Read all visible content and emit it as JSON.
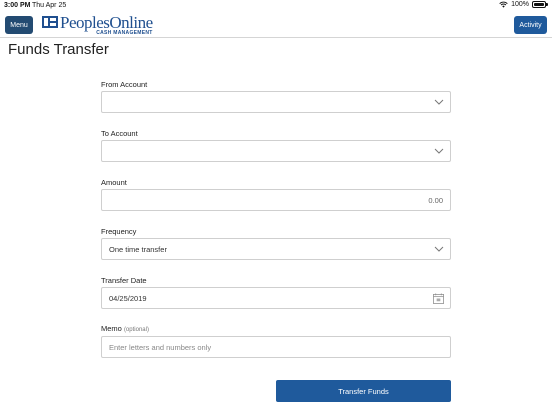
{
  "status_bar": {
    "time": "3:00 PM",
    "date": "Thu Apr 25",
    "battery": "100%",
    "battery_level": 1.0
  },
  "header": {
    "menu_label": "Menu",
    "activity_label": "Activity",
    "logo": {
      "name": "PeoplesOnline",
      "subtitle": "CASH MANAGEMENT"
    }
  },
  "page": {
    "title": "Funds Transfer"
  },
  "form": {
    "from_account": {
      "label": "From Account",
      "value": ""
    },
    "to_account": {
      "label": "To Account",
      "value": ""
    },
    "amount": {
      "label": "Amount",
      "value": "0.00"
    },
    "frequency": {
      "label": "Frequency",
      "value": "One time transfer"
    },
    "transfer_date": {
      "label": "Transfer Date",
      "value": "04/25/2019"
    },
    "memo": {
      "label": "Memo",
      "optional_label": "(optional)",
      "placeholder": "Enter letters and numbers only"
    },
    "submit_label": "Transfer Funds"
  },
  "icons": {
    "dropdown": "chevron-down-icon",
    "calendar": "calendar-icon",
    "wifi": "wifi-icon",
    "battery": "battery-icon"
  },
  "colors": {
    "primary": "#1f5a9c",
    "menu": "#234b72",
    "brand": "#1f4f8f"
  }
}
